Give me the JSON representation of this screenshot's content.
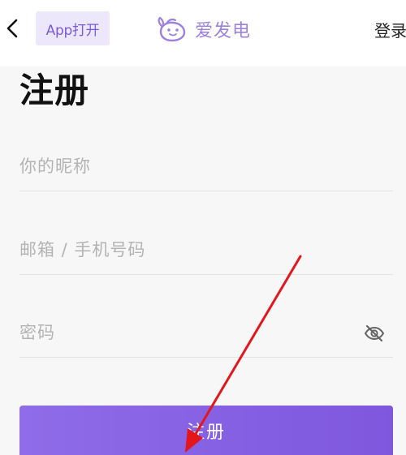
{
  "header": {
    "back_icon": "chevron-left-icon",
    "app_open_label": "App打开",
    "brand_name": "爱发电",
    "brand_logo_icon": "aifadian-logo-icon",
    "login_label": "登录"
  },
  "main": {
    "title": "注册",
    "fields": [
      {
        "placeholder": "你的昵称",
        "value": ""
      },
      {
        "placeholder": "邮箱 / 手机号码",
        "value": ""
      },
      {
        "placeholder": "密码",
        "value": "",
        "toggle_icon": "eye-off-icon"
      }
    ],
    "submit_label": "注册"
  },
  "colors": {
    "accent": "#8a66e6",
    "brand_text": "#9b80e0",
    "app_button_bg": "#ece7fb",
    "annotation_arrow": "#e3161c"
  }
}
